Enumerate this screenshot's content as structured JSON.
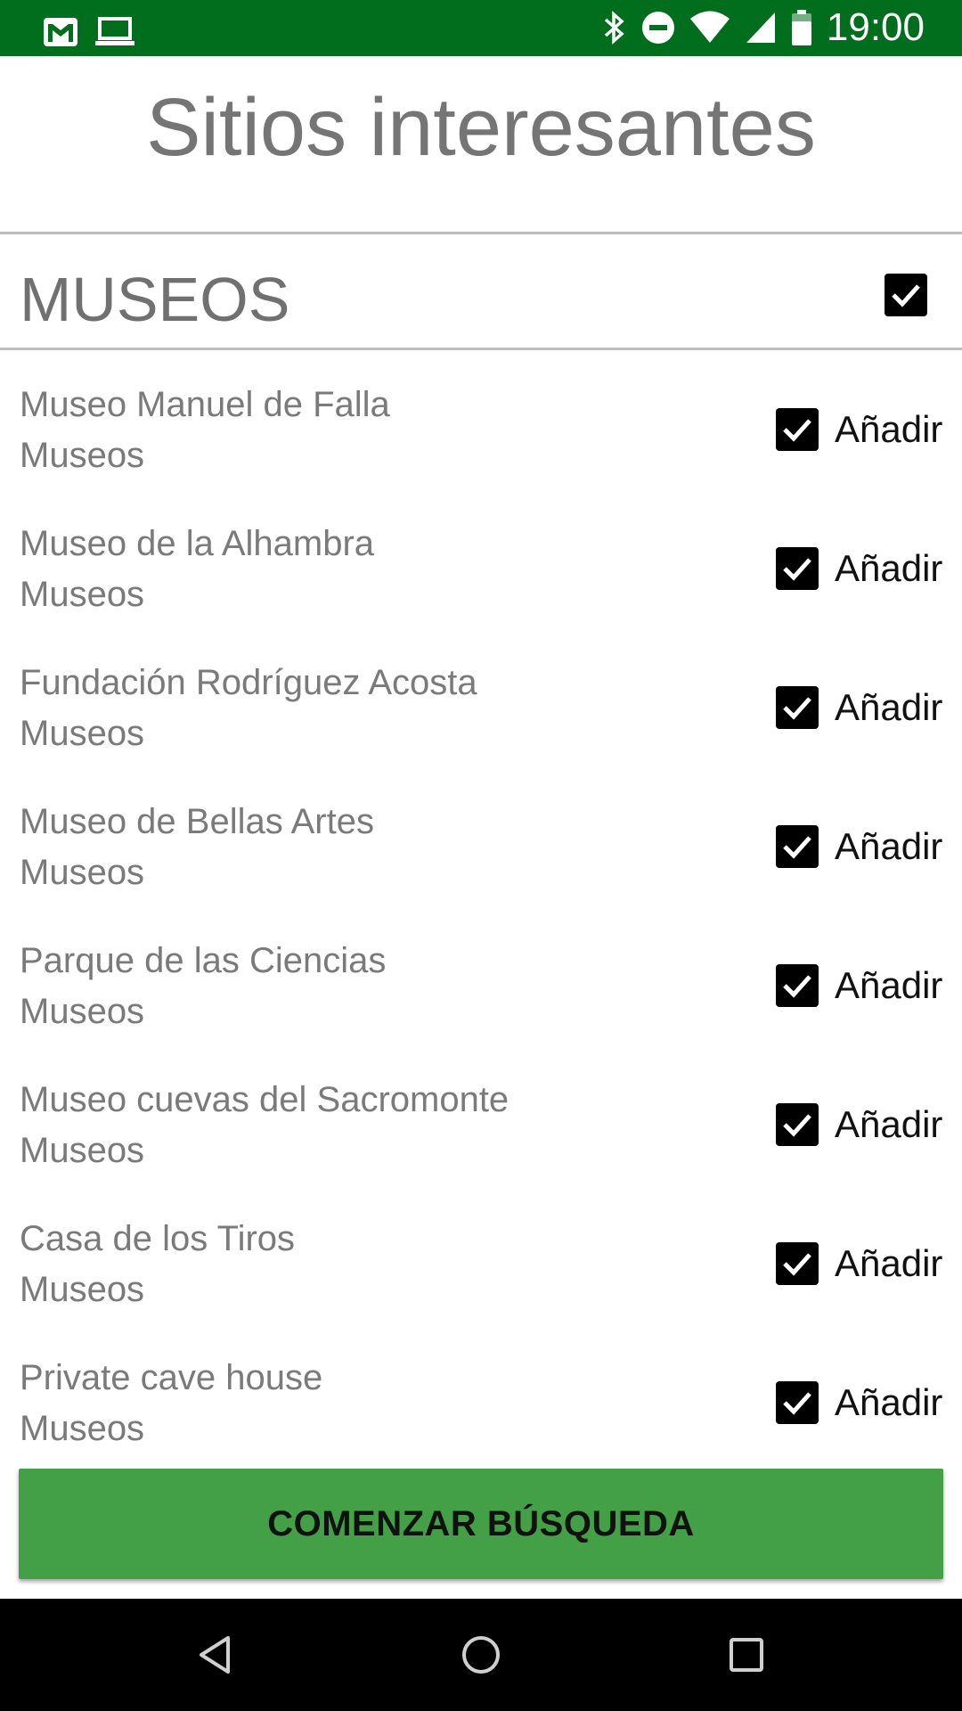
{
  "status_bar": {
    "time": "19:00",
    "left_icons": [
      "gmail-icon",
      "laptop-icon"
    ],
    "right_icons": [
      "bluetooth-icon",
      "do-not-disturb-icon",
      "wifi-icon",
      "signal-icon",
      "battery-icon"
    ],
    "background_color": "#006e1c"
  },
  "header": {
    "title": "Sitios interesantes"
  },
  "section": {
    "label": "MUSEOS",
    "select_all_checked": true
  },
  "items": [
    {
      "name": "Museo Manuel de Falla",
      "category": "Museos",
      "add_label": "Añadir",
      "checked": true
    },
    {
      "name": "Museo de la Alhambra",
      "category": "Museos",
      "add_label": "Añadir",
      "checked": true
    },
    {
      "name": "Fundación Rodríguez Acosta",
      "category": "Museos",
      "add_label": "Añadir",
      "checked": true
    },
    {
      "name": "Museo de Bellas Artes",
      "category": "Museos",
      "add_label": "Añadir",
      "checked": true
    },
    {
      "name": "Parque de las Ciencias",
      "category": "Museos",
      "add_label": "Añadir",
      "checked": true
    },
    {
      "name": "Museo cuevas del Sacromonte",
      "category": "Museos",
      "add_label": "Añadir",
      "checked": true
    },
    {
      "name": "Casa de los Tiros",
      "category": "Museos",
      "add_label": "Añadir",
      "checked": true
    },
    {
      "name": "Private cave house",
      "category": "Museos",
      "add_label": "Añadir",
      "checked": true
    }
  ],
  "footer": {
    "start_button_label": "COMENZAR BÚSQUEDA",
    "button_color": "#43a047"
  },
  "nav_bar": {
    "buttons": [
      "back-icon",
      "home-icon",
      "recents-icon"
    ]
  }
}
